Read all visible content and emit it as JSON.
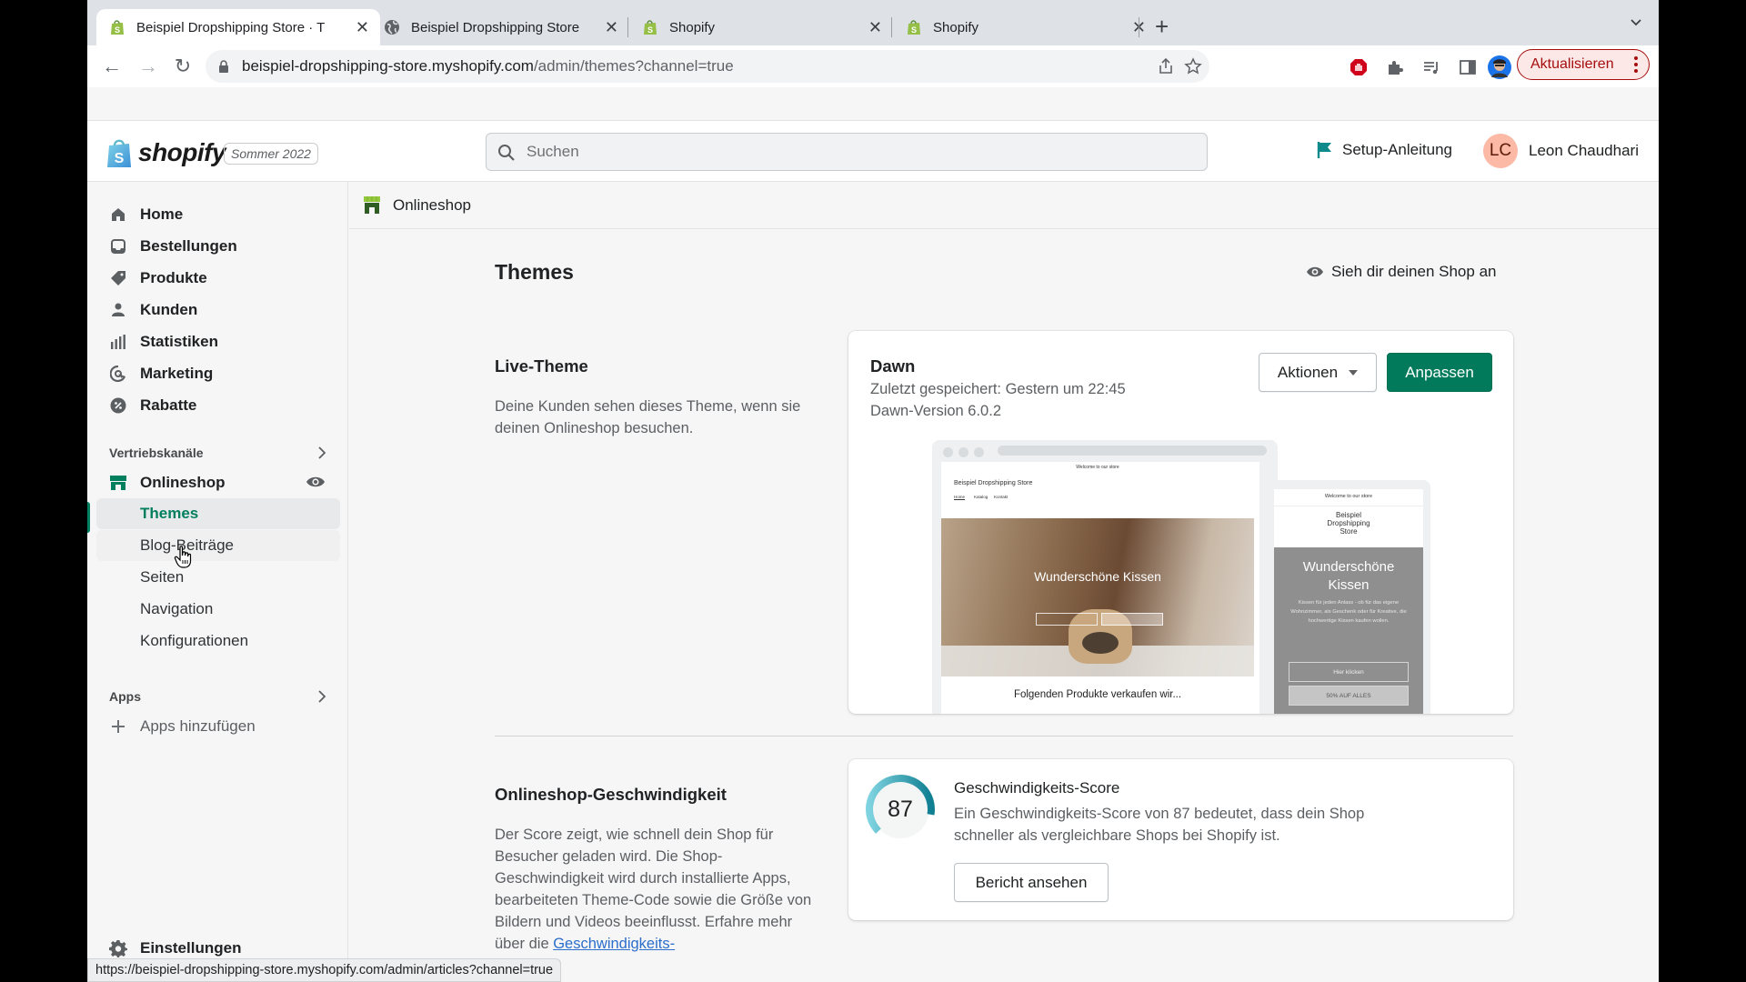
{
  "browser": {
    "tabs": [
      {
        "title": "Beispiel Dropshipping Store · T",
        "favicon": "shopify-bag-icon",
        "active": true
      },
      {
        "title": "Beispiel Dropshipping Store",
        "favicon": "globe-icon",
        "active": false
      },
      {
        "title": "Shopify",
        "favicon": "shopify-bag-icon",
        "active": false
      },
      {
        "title": "Shopify",
        "favicon": "shopify-bag-icon",
        "active": false
      }
    ],
    "new_tab_label": "+",
    "url_host": "beispiel-dropshipping-store.myshopify.com",
    "url_path": "/admin/themes?channel=true",
    "update_label": "Aktualisieren",
    "status_url": "https://beispiel-dropshipping-store.myshopify.com/admin/articles?channel=true"
  },
  "header": {
    "logo_text": "shopify",
    "edition": "Sommer 2022",
    "search_placeholder": "Suchen",
    "setup_label": "Setup-Anleitung",
    "user_initials": "LC",
    "user_name": "Leon Chaudhari"
  },
  "sidebar": {
    "items": [
      {
        "label": "Home",
        "icon": "home-icon"
      },
      {
        "label": "Bestellungen",
        "icon": "orders-inbox-icon"
      },
      {
        "label": "Produkte",
        "icon": "tag-icon"
      },
      {
        "label": "Kunden",
        "icon": "person-icon"
      },
      {
        "label": "Statistiken",
        "icon": "bar-chart-icon"
      },
      {
        "label": "Marketing",
        "icon": "target-icon"
      },
      {
        "label": "Rabatte",
        "icon": "discount-icon"
      }
    ],
    "sales_channels_title": "Vertriebskanäle",
    "online_store_label": "Onlineshop",
    "online_store_sub": [
      {
        "label": "Themes",
        "active": true
      },
      {
        "label": "Blog-Beiträge",
        "hover": true
      },
      {
        "label": "Seiten"
      },
      {
        "label": "Navigation"
      },
      {
        "label": "Konfigurationen"
      }
    ],
    "apps_title": "Apps",
    "add_apps_label": "Apps hinzufügen",
    "settings_label": "Einstellungen"
  },
  "channel_bar": {
    "title": "Onlineshop"
  },
  "main": {
    "page_title": "Themes",
    "view_shop_label": "Sieh dir deinen Shop an",
    "live_theme": {
      "section_title": "Live-Theme",
      "section_desc": "Deine Kunden sehen dieses Theme, wenn sie deinen Onlineshop besuchen.",
      "theme_name": "Dawn",
      "last_saved": "Zuletzt gespeichert: Gestern um 22:45",
      "version": "Dawn-Version 6.0.2",
      "actions_label": "Aktionen",
      "customize_label": "Anpassen",
      "preview": {
        "announcement": "Welcome to our store",
        "store_name": "Beispiel Dropshipping Store",
        "store_name_mobile": [
          "Beispiel",
          "Dropshipping",
          "Store"
        ],
        "nav": [
          "Home",
          "Katalog",
          "Kontakt"
        ],
        "hero_title": "Wunderschöne Kissen",
        "hero_title_mobile": [
          "Wunderschöne",
          "Kissen"
        ],
        "hero_text": "Kissen für jeden Anlass - ob für das eigene Wohnzimmer, als Geschenk oder für Kreative, die hochwertige Kissen kaufen wollen.",
        "btn_primary": "Hier klicken",
        "btn_secondary": "50% AUF ALLES",
        "products_heading": "Folgenden Produkte verkaufen wir..."
      }
    },
    "speed": {
      "section_title": "Onlineshop-Geschwindigkeit",
      "section_desc": "Der Score zeigt, wie schnell dein Shop für Besucher geladen wird. Die Shop-Geschwindigkeit wird durch installierte Apps, bearbeiteten Theme-Code sowie die Größe von Bildern und Videos beeinflusst. Erfahre mehr über die ",
      "section_link": "Geschwindigkeits-",
      "score": 87,
      "score_max": 100,
      "score_title": "Geschwindigkeits-Score",
      "score_desc": "Ein Geschwindigkeits-Score von 87 bedeutet, dass dein Shop schneller als vergleichbare Shops bei Shopify ist.",
      "report_label": "Bericht ansehen"
    }
  },
  "colors": {
    "primary_green": "#007a5a",
    "active_text": "#007f5f",
    "link_blue": "#2c6ecb",
    "score_teal": "#1f95a8",
    "setup_flag": "#0e8a8a",
    "avatar_bg": "#fbb9a6",
    "update_red": "#a50e0e"
  }
}
